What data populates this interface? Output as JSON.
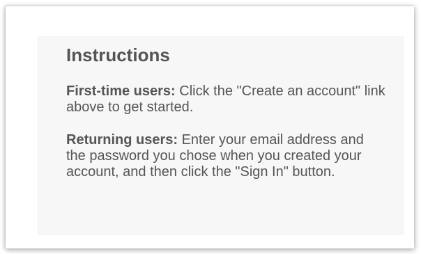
{
  "instructions": {
    "title": "Instructions",
    "first_time": {
      "label": "First-time users:",
      "text": " Click the \"Create an account\" link above to get started."
    },
    "returning": {
      "label": "Returning users:",
      "text": " Enter your email address and the password you chose when you created your account, and then click the \"Sign In\" button."
    }
  },
  "colors": {
    "panel_background": "#f7f7f7",
    "text": "#555555"
  }
}
